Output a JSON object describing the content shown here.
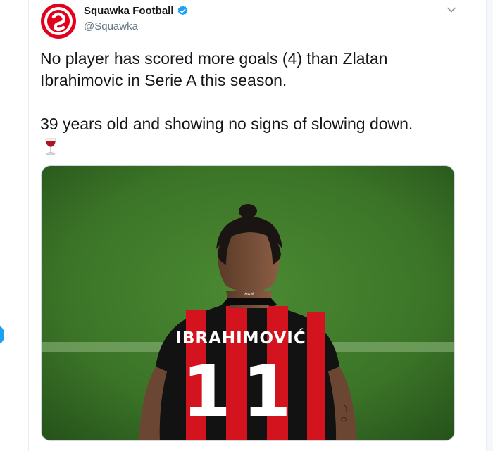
{
  "tweet": {
    "author": {
      "display_name": "Squawka Football",
      "handle": "@Squawka",
      "verified": true,
      "avatar_icon": "squawka-logo"
    },
    "text_line_1": "No player has scored more goals (4) than Zlatan",
    "text_line_2": "Ibrahimovic in Serie A this season.",
    "text_line_3": "39 years old and showing no signs of slowing down.",
    "emoji_icon": "wine-glass-icon",
    "menu_icon": "chevron-down-icon",
    "media": {
      "jersey_name": "IBRAHIMOVIĆ",
      "jersey_number": "11",
      "collar_label": "ACM"
    }
  },
  "colors": {
    "brand_red": "#e3001b",
    "verified_blue": "#1da1f2",
    "pitch_green": "#3f7d2c",
    "jersey_red": "#d3141e",
    "jersey_black": "#121212"
  }
}
